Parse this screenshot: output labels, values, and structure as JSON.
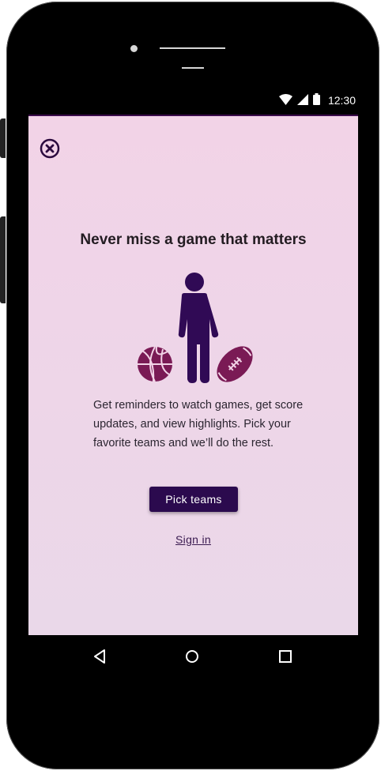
{
  "status_bar": {
    "time": "12:30",
    "icons": [
      "wifi-icon",
      "cell-signal-icon",
      "battery-icon"
    ]
  },
  "onboarding": {
    "close_icon": "close-circle-icon",
    "title": "Never miss a game that matters",
    "illustration_icons": [
      "person-icon",
      "basketball-icon",
      "football-icon"
    ],
    "body": "Get reminders to watch games, get score updates, and view highlights. Pick your favorite teams and we’ll do the rest.",
    "primary_button": "Pick teams",
    "secondary_link": "Sign in"
  },
  "nav_bar": {
    "buttons": [
      "back-icon",
      "home-icon",
      "recents-icon"
    ]
  },
  "colors": {
    "accent": "#2b0a4e",
    "background": "#f2d3e7",
    "ball": "#7a1a55"
  }
}
